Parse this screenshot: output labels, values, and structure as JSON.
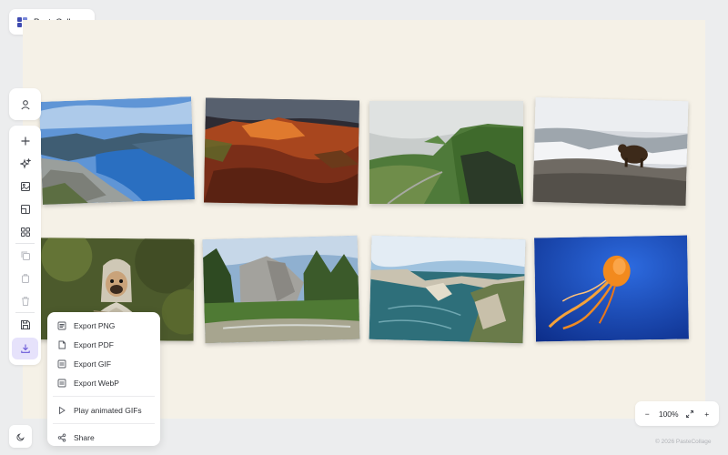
{
  "app": {
    "title": "PasteCollage"
  },
  "toolbar": {
    "items": [
      {
        "icon": "user-icon",
        "label": ""
      },
      {
        "icon": "plus-icon",
        "label": ""
      },
      {
        "icon": "sparkle-icon",
        "label": ""
      },
      {
        "icon": "image-icon",
        "label": ""
      },
      {
        "icon": "crop-icon",
        "label": ""
      },
      {
        "icon": "grid-layout-icon",
        "label": ""
      },
      {
        "icon": "duplicate-icon",
        "label": ""
      },
      {
        "icon": "copy-icon",
        "label": ""
      },
      {
        "icon": "trash-icon",
        "label": ""
      },
      {
        "icon": "save-icon",
        "label": ""
      },
      {
        "icon": "download-icon",
        "label": ""
      }
    ]
  },
  "export_menu": {
    "items": [
      {
        "label": "Export PNG",
        "icon": "png-file-icon"
      },
      {
        "label": "Export PDF",
        "icon": "pdf-file-icon"
      },
      {
        "label": "Export GIF",
        "icon": "gif-file-icon"
      },
      {
        "label": "Export WebP",
        "icon": "webp-file-icon"
      },
      {
        "label": "Play animated GIFs",
        "icon": "play-icon"
      },
      {
        "label": "Share",
        "icon": "share-icon"
      }
    ]
  },
  "photos": [
    {
      "subject": "fjord-landscape"
    },
    {
      "subject": "red-rock-canyon"
    },
    {
      "subject": "green-cliffs-valley"
    },
    {
      "subject": "bear-on-rocks"
    },
    {
      "subject": "pug-in-blanket"
    },
    {
      "subject": "yosemite-valley"
    },
    {
      "subject": "coastal-cliffs"
    },
    {
      "subject": "orange-jellyfish"
    }
  ],
  "zoom": {
    "level": "100%",
    "minus": "−",
    "plus": "+"
  },
  "footer": {
    "copyright": "© 2026 PasteCollage"
  },
  "colors": {
    "accent": "#7b6ee6",
    "canvas": "#f5f1e7",
    "brand": "#3f4bb0"
  }
}
